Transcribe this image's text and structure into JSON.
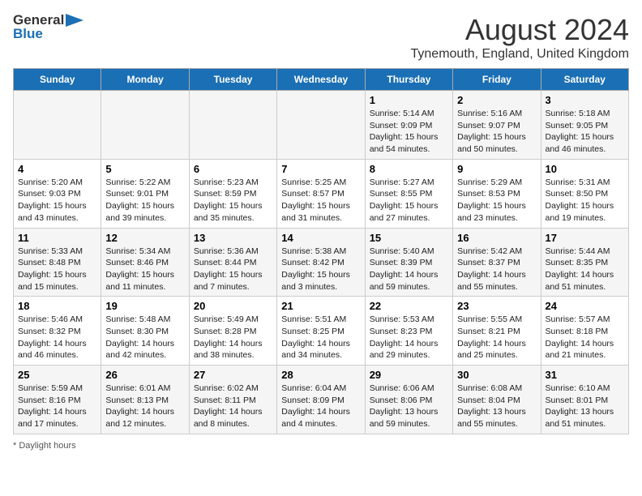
{
  "header": {
    "logo_general": "General",
    "logo_blue": "Blue",
    "title": "August 2024",
    "subtitle": "Tynemouth, England, United Kingdom"
  },
  "days_of_week": [
    "Sunday",
    "Monday",
    "Tuesday",
    "Wednesday",
    "Thursday",
    "Friday",
    "Saturday"
  ],
  "weeks": [
    [
      {
        "day": "",
        "info": ""
      },
      {
        "day": "",
        "info": ""
      },
      {
        "day": "",
        "info": ""
      },
      {
        "day": "",
        "info": ""
      },
      {
        "day": "1",
        "sunrise": "Sunrise: 5:14 AM",
        "sunset": "Sunset: 9:09 PM",
        "daylight": "Daylight: 15 hours and 54 minutes."
      },
      {
        "day": "2",
        "sunrise": "Sunrise: 5:16 AM",
        "sunset": "Sunset: 9:07 PM",
        "daylight": "Daylight: 15 hours and 50 minutes."
      },
      {
        "day": "3",
        "sunrise": "Sunrise: 5:18 AM",
        "sunset": "Sunset: 9:05 PM",
        "daylight": "Daylight: 15 hours and 46 minutes."
      }
    ],
    [
      {
        "day": "4",
        "sunrise": "Sunrise: 5:20 AM",
        "sunset": "Sunset: 9:03 PM",
        "daylight": "Daylight: 15 hours and 43 minutes."
      },
      {
        "day": "5",
        "sunrise": "Sunrise: 5:22 AM",
        "sunset": "Sunset: 9:01 PM",
        "daylight": "Daylight: 15 hours and 39 minutes."
      },
      {
        "day": "6",
        "sunrise": "Sunrise: 5:23 AM",
        "sunset": "Sunset: 8:59 PM",
        "daylight": "Daylight: 15 hours and 35 minutes."
      },
      {
        "day": "7",
        "sunrise": "Sunrise: 5:25 AM",
        "sunset": "Sunset: 8:57 PM",
        "daylight": "Daylight: 15 hours and 31 minutes."
      },
      {
        "day": "8",
        "sunrise": "Sunrise: 5:27 AM",
        "sunset": "Sunset: 8:55 PM",
        "daylight": "Daylight: 15 hours and 27 minutes."
      },
      {
        "day": "9",
        "sunrise": "Sunrise: 5:29 AM",
        "sunset": "Sunset: 8:53 PM",
        "daylight": "Daylight: 15 hours and 23 minutes."
      },
      {
        "day": "10",
        "sunrise": "Sunrise: 5:31 AM",
        "sunset": "Sunset: 8:50 PM",
        "daylight": "Daylight: 15 hours and 19 minutes."
      }
    ],
    [
      {
        "day": "11",
        "sunrise": "Sunrise: 5:33 AM",
        "sunset": "Sunset: 8:48 PM",
        "daylight": "Daylight: 15 hours and 15 minutes."
      },
      {
        "day": "12",
        "sunrise": "Sunrise: 5:34 AM",
        "sunset": "Sunset: 8:46 PM",
        "daylight": "Daylight: 15 hours and 11 minutes."
      },
      {
        "day": "13",
        "sunrise": "Sunrise: 5:36 AM",
        "sunset": "Sunset: 8:44 PM",
        "daylight": "Daylight: 15 hours and 7 minutes."
      },
      {
        "day": "14",
        "sunrise": "Sunrise: 5:38 AM",
        "sunset": "Sunset: 8:42 PM",
        "daylight": "Daylight: 15 hours and 3 minutes."
      },
      {
        "day": "15",
        "sunrise": "Sunrise: 5:40 AM",
        "sunset": "Sunset: 8:39 PM",
        "daylight": "Daylight: 14 hours and 59 minutes."
      },
      {
        "day": "16",
        "sunrise": "Sunrise: 5:42 AM",
        "sunset": "Sunset: 8:37 PM",
        "daylight": "Daylight: 14 hours and 55 minutes."
      },
      {
        "day": "17",
        "sunrise": "Sunrise: 5:44 AM",
        "sunset": "Sunset: 8:35 PM",
        "daylight": "Daylight: 14 hours and 51 minutes."
      }
    ],
    [
      {
        "day": "18",
        "sunrise": "Sunrise: 5:46 AM",
        "sunset": "Sunset: 8:32 PM",
        "daylight": "Daylight: 14 hours and 46 minutes."
      },
      {
        "day": "19",
        "sunrise": "Sunrise: 5:48 AM",
        "sunset": "Sunset: 8:30 PM",
        "daylight": "Daylight: 14 hours and 42 minutes."
      },
      {
        "day": "20",
        "sunrise": "Sunrise: 5:49 AM",
        "sunset": "Sunset: 8:28 PM",
        "daylight": "Daylight: 14 hours and 38 minutes."
      },
      {
        "day": "21",
        "sunrise": "Sunrise: 5:51 AM",
        "sunset": "Sunset: 8:25 PM",
        "daylight": "Daylight: 14 hours and 34 minutes."
      },
      {
        "day": "22",
        "sunrise": "Sunrise: 5:53 AM",
        "sunset": "Sunset: 8:23 PM",
        "daylight": "Daylight: 14 hours and 29 minutes."
      },
      {
        "day": "23",
        "sunrise": "Sunrise: 5:55 AM",
        "sunset": "Sunset: 8:21 PM",
        "daylight": "Daylight: 14 hours and 25 minutes."
      },
      {
        "day": "24",
        "sunrise": "Sunrise: 5:57 AM",
        "sunset": "Sunset: 8:18 PM",
        "daylight": "Daylight: 14 hours and 21 minutes."
      }
    ],
    [
      {
        "day": "25",
        "sunrise": "Sunrise: 5:59 AM",
        "sunset": "Sunset: 8:16 PM",
        "daylight": "Daylight: 14 hours and 17 minutes."
      },
      {
        "day": "26",
        "sunrise": "Sunrise: 6:01 AM",
        "sunset": "Sunset: 8:13 PM",
        "daylight": "Daylight: 14 hours and 12 minutes."
      },
      {
        "day": "27",
        "sunrise": "Sunrise: 6:02 AM",
        "sunset": "Sunset: 8:11 PM",
        "daylight": "Daylight: 14 hours and 8 minutes."
      },
      {
        "day": "28",
        "sunrise": "Sunrise: 6:04 AM",
        "sunset": "Sunset: 8:09 PM",
        "daylight": "Daylight: 14 hours and 4 minutes."
      },
      {
        "day": "29",
        "sunrise": "Sunrise: 6:06 AM",
        "sunset": "Sunset: 8:06 PM",
        "daylight": "Daylight: 13 hours and 59 minutes."
      },
      {
        "day": "30",
        "sunrise": "Sunrise: 6:08 AM",
        "sunset": "Sunset: 8:04 PM",
        "daylight": "Daylight: 13 hours and 55 minutes."
      },
      {
        "day": "31",
        "sunrise": "Sunrise: 6:10 AM",
        "sunset": "Sunset: 8:01 PM",
        "daylight": "Daylight: 13 hours and 51 minutes."
      }
    ]
  ],
  "footer": {
    "note": "Daylight hours"
  }
}
